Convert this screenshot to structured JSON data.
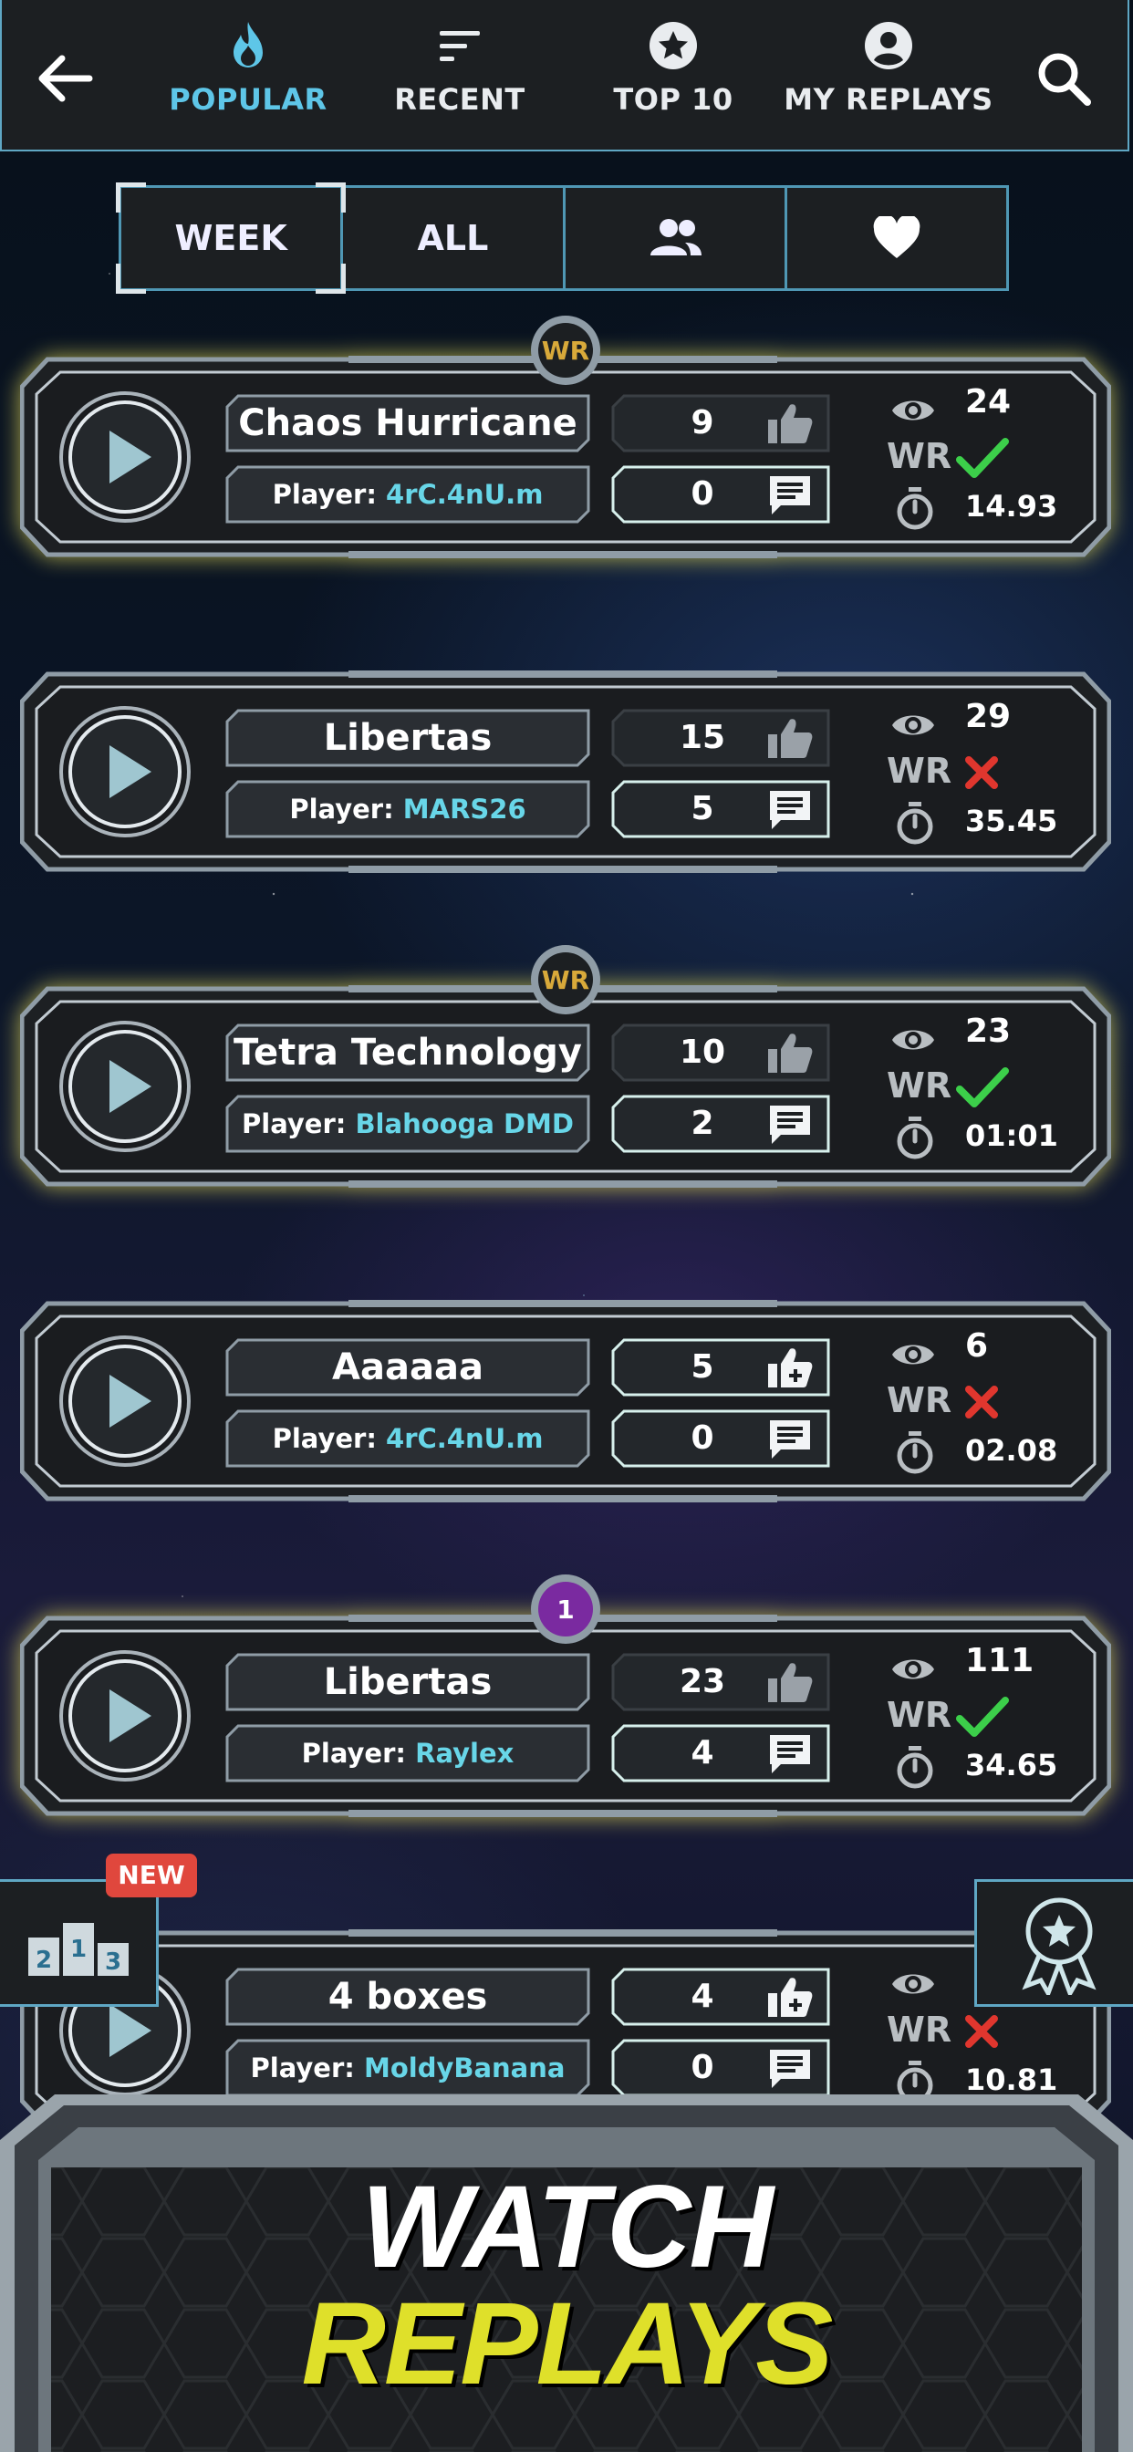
{
  "header": {
    "tabs": [
      {
        "label": "POPULAR",
        "icon": "flame-icon",
        "active": true
      },
      {
        "label": "RECENT",
        "icon": "sort-lines-icon",
        "active": false
      },
      {
        "label": "TOP 10",
        "icon": "star-circle-icon",
        "active": false
      },
      {
        "label": "MY REPLAYS",
        "icon": "user-circle-icon",
        "active": false
      }
    ]
  },
  "filter": {
    "segments": [
      {
        "label": "WEEK",
        "active": true
      },
      {
        "label": "ALL",
        "active": false
      },
      {
        "label": "",
        "icon": "friends-icon"
      },
      {
        "label": "",
        "icon": "heart-icon"
      }
    ]
  },
  "replays": [
    {
      "title": "Chaos Hurricane",
      "player_prefix": "Player:",
      "player": "4rC.4nU.m",
      "likes": "9",
      "comments": "0",
      "views": "24",
      "wr_label": "WR",
      "wr": true,
      "time": "14.93",
      "badge": "WR",
      "liked": false
    },
    {
      "title": "Libertas",
      "player_prefix": "Player:",
      "player": "MARS26",
      "likes": "15",
      "comments": "5",
      "views": "29",
      "wr_label": "WR",
      "wr": false,
      "time": "35.45",
      "badge": "",
      "liked": false
    },
    {
      "title": "Tetra Technology",
      "player_prefix": "Player:",
      "player": "Blahooga DMD",
      "likes": "10",
      "comments": "2",
      "views": "23",
      "wr_label": "WR",
      "wr": true,
      "time": "01:01",
      "badge": "WR",
      "liked": false
    },
    {
      "title": "Aaaaaa",
      "player_prefix": "Player:",
      "player": "4rC.4nU.m",
      "likes": "5",
      "comments": "0",
      "views": "6",
      "wr_label": "WR",
      "wr": false,
      "time": "02.08",
      "badge": "",
      "liked": true
    },
    {
      "title": "Libertas",
      "player_prefix": "Player:",
      "player": "Raylex",
      "likes": "23",
      "comments": "4",
      "views": "111",
      "wr_label": "WR",
      "wr": true,
      "time": "34.65",
      "badge": "1",
      "liked": false
    },
    {
      "title": "4 boxes",
      "player_prefix": "Player:",
      "player": "MoldyBanana",
      "likes": "4",
      "comments": "0",
      "views": "",
      "wr_label": "WR",
      "wr": false,
      "time": "10.81",
      "badge": "",
      "liked": true
    }
  ],
  "leaderboard_button": {
    "new_badge": "NEW",
    "icon": "podium-123-icon",
    "digits": [
      "2",
      "1",
      "3"
    ]
  },
  "achievements_button": {
    "icon": "award-ribbon-icon"
  },
  "banner": {
    "line1": "WATCH",
    "line2": "REPLAYS"
  },
  "colors": {
    "accent": "#5ec6e8",
    "player_name": "#68d6e8",
    "gold": "#d8a93a",
    "check": "#3ccf4a",
    "cross": "#e0362e",
    "glow": "#e6dc5a",
    "banner_yellow": "#dfe02a"
  }
}
